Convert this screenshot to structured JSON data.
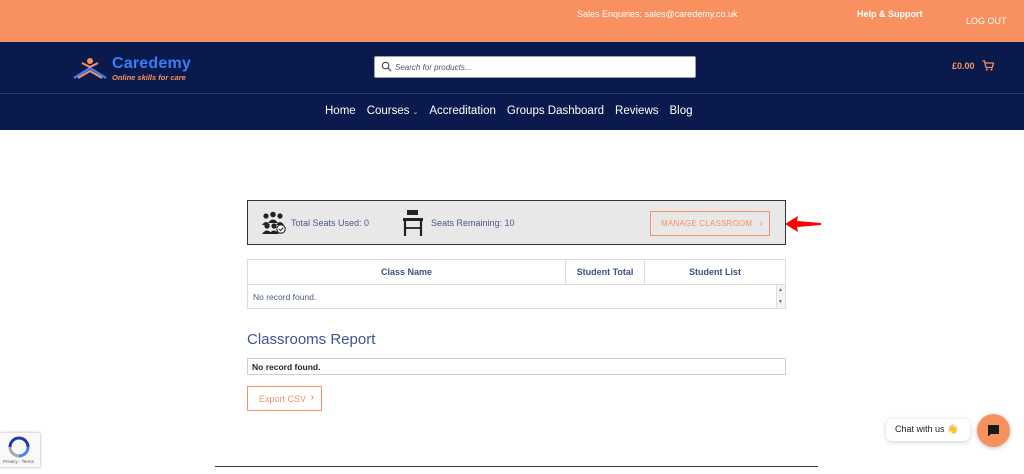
{
  "topbar": {
    "sales_enquiries": "Sales Enquiries: sales@caredemy.co.uk",
    "help_support": "Help & Support",
    "logout": "LOG OUT"
  },
  "header": {
    "logo_name": "Caredemy",
    "logo_tagline": "Online skills for care",
    "search_placeholder": "Search for products...",
    "cart_total": "£0.00"
  },
  "nav": {
    "items": [
      {
        "label": "Home"
      },
      {
        "label": "Courses"
      },
      {
        "label": "Accreditation"
      },
      {
        "label": "Groups Dashboard"
      },
      {
        "label": "Reviews"
      },
      {
        "label": "Blog"
      }
    ]
  },
  "seats": {
    "total_used_label": "Total Seats Used: 0",
    "remaining_label": "Seats Remaining: 10",
    "manage_button": "MANAGE CLASSROOM",
    "button_chevron": "›"
  },
  "class_table": {
    "headers": [
      "Class Name",
      "Student Total",
      "Student List"
    ],
    "empty_message": "No record found."
  },
  "report": {
    "title": "Classrooms Report",
    "empty_message": "No record found.",
    "export_button": "Export CSV",
    "export_chevron": "›"
  },
  "recaptcha": {
    "footer": "Privacy - Terms"
  },
  "chat": {
    "label": "Chat with us 👋"
  },
  "colors": {
    "brand_orange": "#f8915f",
    "navy": "#0b1a4d",
    "annotation_arrow": "#ff0000"
  }
}
